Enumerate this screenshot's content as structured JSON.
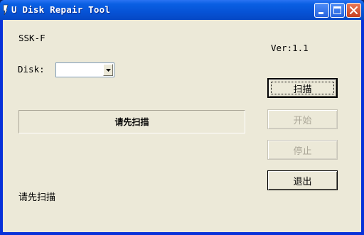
{
  "window": {
    "title": "U Disk Repair Tool",
    "icon": "app-icon",
    "controls": [
      "minimize-icon",
      "maximize-icon",
      "close-icon"
    ]
  },
  "main": {
    "device_name": "SSK-F",
    "version": "Ver:1.1",
    "disk_label": "Disk:",
    "disk_selected": "",
    "status_box_text": "请先扫描",
    "status_line": "请先扫描"
  },
  "buttons": {
    "scan": "扫描",
    "start": "开始",
    "stop": "停止",
    "exit": "退出"
  },
  "colors": {
    "titlebar": "#0653d6",
    "dialog_bg": "#ece9d8",
    "disabled_text": "#aca899"
  }
}
